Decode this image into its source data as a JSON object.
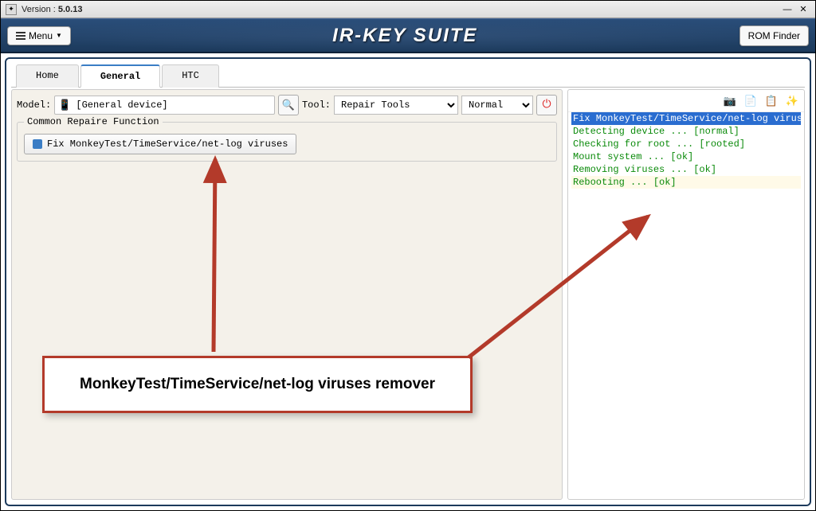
{
  "titlebar": {
    "version_label": "Version :",
    "version": "5.0.13"
  },
  "header": {
    "menu_label": "Menu",
    "menu_caret": "▼",
    "title": "IR-KEY SUITE",
    "rom_label": "ROM Finder"
  },
  "tabs": [
    {
      "label": "Home",
      "active": false
    },
    {
      "label": "General",
      "active": true
    },
    {
      "label": "HTC",
      "active": false
    }
  ],
  "toolbar": {
    "model_label": "Model:",
    "model_value": "[General device]",
    "tool_label": "Tool:",
    "tool_select": "Repair Tools",
    "mode_select": "Normal"
  },
  "fieldset": {
    "legend": "Common Repaire Function",
    "fix_button": "Fix MonkeyTest/TimeService/net-log viruses"
  },
  "log": [
    {
      "text": "Fix MonkeyTest/TimeService/net-log viruses",
      "cls": "log-hl"
    },
    {
      "text": "Detecting device ... [normal]",
      "cls": "log-ok"
    },
    {
      "text": "Checking for root ... [rooted]",
      "cls": "log-ok"
    },
    {
      "text": "Mount system ... [ok]",
      "cls": "log-ok"
    },
    {
      "text": "Removing viruses ... [ok]",
      "cls": "log-ok"
    },
    {
      "text": "Rebooting ... [ok]",
      "cls": "log-reboot"
    }
  ],
  "callout": {
    "text": "MonkeyTest/TimeService/net-log viruses remover"
  }
}
